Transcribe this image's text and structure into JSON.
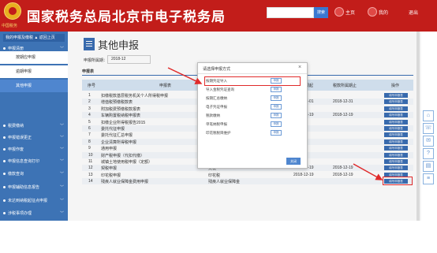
{
  "header": {
    "title": "国家税务总局北京市电子税务局",
    "logo_sub": "中国税务",
    "search_button": "搜索",
    "links": [
      "主页",
      "我的"
    ],
    "logout": "退出"
  },
  "sidebar": {
    "top_buttons": "我的申报及缴税  ▲  返回上页",
    "items": [
      {
        "label": "申报清册",
        "expanded": true
      },
      {
        "label": "税费缴纳"
      },
      {
        "label": "申报错误更正"
      },
      {
        "label": "申报作废"
      },
      {
        "label": "申报信息查询打印"
      },
      {
        "label": "缴款查询"
      },
      {
        "label": "申报辅助信息报告"
      },
      {
        "label": "未达到纳税起征点申报"
      },
      {
        "label": "涉税事项办理"
      },
      {
        "label": "逾期事项"
      },
      {
        "label": "工会经费（筹备金）申报"
      },
      {
        "label": "非税申报"
      }
    ],
    "sub_items": [
      {
        "label": "按期应申报"
      },
      {
        "label": "逾期申报"
      },
      {
        "label": "其他申报",
        "active": true
      }
    ]
  },
  "page": {
    "title": "其他申报",
    "period_label": "申报所属期：",
    "period_value": "2018-12",
    "section_title": "申报表",
    "columns": [
      "序号",
      "申报表",
      "纳税期限起",
      "税款所属期止",
      "税款所属期止",
      "操作"
    ],
    "rows": [
      {
        "no": "1",
        "name": "扣缴税款基层税务机关个人所得税申报",
        "type": "",
        "start": "",
        "end": "",
        "action": "填写申报表"
      },
      {
        "no": "2",
        "name": "增值税预缴税款表",
        "type": "",
        "start": "2018-12-01",
        "end": "2018-12-31",
        "action": "填写申报表"
      },
      {
        "no": "3",
        "name": "附加税费预缴税款报表",
        "type": "",
        "start": "",
        "end": "",
        "action": "填写申报表"
      },
      {
        "no": "4",
        "name": "车辆购置税纳税申报表",
        "type": "",
        "start": "2018-12-19",
        "end": "2018-12-19",
        "action": "填写申报表"
      },
      {
        "no": "5",
        "name": "扣缴企业所得税报告2015",
        "type": "",
        "start": "",
        "end": "",
        "action": "填写申报表"
      },
      {
        "no": "6",
        "name": "委托代征申报",
        "type": "",
        "start": "",
        "end": "",
        "action": "填写申报表"
      },
      {
        "no": "7",
        "name": "委托代征汇总申报",
        "type": "",
        "start": "",
        "end": "",
        "action": "填写申报表"
      },
      {
        "no": "8",
        "name": "企业清算所得税申报",
        "type": "",
        "start": "",
        "end": "",
        "action": "填写申报表"
      },
      {
        "no": "9",
        "name": "通用申报",
        "type": "",
        "start": "",
        "end": "",
        "action": "填写申报表"
      },
      {
        "no": "10",
        "name": "财产税申报（代扣代缴）",
        "type": "财产税",
        "start": "",
        "end": "",
        "action": "填写申报表"
      },
      {
        "no": "11",
        "name": "城镇土地使用税申报（定额）",
        "type": "城镇土地使用税",
        "start": "",
        "end": "",
        "action": "填写申报表"
      },
      {
        "no": "12",
        "name": "契税申报",
        "type": "契税",
        "start": "2018-12-19",
        "end": "2018-12-19",
        "action": "填写申报表"
      },
      {
        "no": "13",
        "name": "印花税申报",
        "type": "印花税",
        "start": "2018-12-19",
        "end": "2018-12-19",
        "action": "填写申报表"
      },
      {
        "no": "14",
        "name": "残疾人就业保障金费用申报",
        "type": "残疾人就业保障金",
        "start": "",
        "end": "",
        "action": "填写申报表"
      }
    ]
  },
  "modal": {
    "title": "请选择申报方式",
    "close_symbol": "×",
    "options": [
      {
        "label": "按期凭证导入",
        "button": "申报"
      },
      {
        "label": "导入金税凭证查询",
        "button": "申报"
      },
      {
        "label": "按期汇总缴纳",
        "button": "申报"
      },
      {
        "label": "电子凭证申报",
        "button": "申报"
      },
      {
        "label": "税款缴纳",
        "button": "申报"
      },
      {
        "label": "单笔纳税申报",
        "button": "申报"
      },
      {
        "label": "印花税税目维护",
        "button": "申报"
      }
    ],
    "close_button": "关闭"
  },
  "right_rail_icons": [
    "home-icon",
    "phone-icon",
    "chat-icon",
    "help-icon",
    "doc-icon",
    "list-icon"
  ],
  "colors": {
    "header_red": "#c21d1a",
    "sidebar_blue": "#3d73b5",
    "accent_blue": "#3b6fb5",
    "highlight_red": "#e02a2a"
  }
}
